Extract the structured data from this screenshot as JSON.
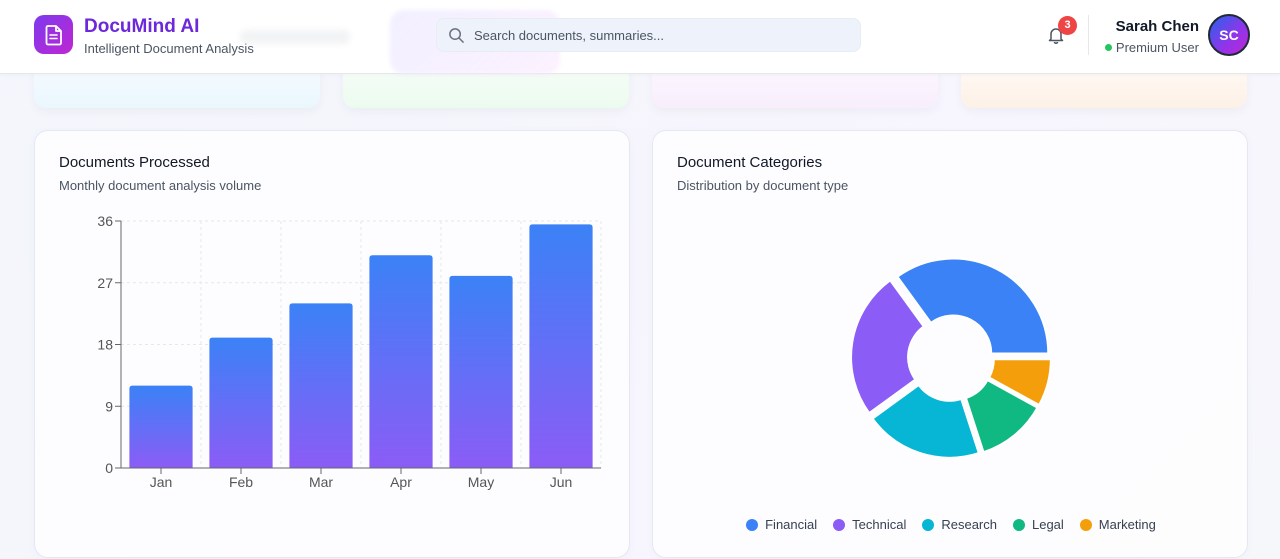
{
  "app": {
    "title": "DocuMind AI",
    "subtitle": "Intelligent Document Analysis",
    "logo_icon": "document-icon",
    "brand_color": "#6d28d9"
  },
  "search": {
    "placeholder": "Search documents, summaries..."
  },
  "notifications": {
    "count": "3"
  },
  "user": {
    "name": "Sarah Chen",
    "status": "Premium User",
    "initials": "SC"
  },
  "bar_card": {
    "title": "Documents Processed",
    "subtitle": "Monthly document analysis volume"
  },
  "pie_card": {
    "title": "Document Categories",
    "subtitle": "Distribution by document type"
  },
  "chart_data": [
    {
      "type": "bar",
      "title": "Documents Processed",
      "subtitle": "Monthly document analysis volume",
      "categories": [
        "Jan",
        "Feb",
        "Mar",
        "Apr",
        "May",
        "Jun"
      ],
      "values": [
        12,
        19,
        24,
        31,
        28,
        35.5
      ],
      "ylim": [
        0,
        36
      ],
      "yticks": [
        0,
        9,
        18,
        27,
        36
      ],
      "grid": true,
      "gradient_colors": [
        "#3b82f6",
        "#8b5cf6"
      ]
    },
    {
      "type": "pie",
      "title": "Document Categories",
      "subtitle": "Distribution by document type",
      "donut": true,
      "labels": [
        "Financial",
        "Technical",
        "Research",
        "Legal",
        "Marketing"
      ],
      "values": [
        35,
        25,
        20,
        12,
        8
      ],
      "colors": [
        "#3b82f6",
        "#8b5cf6",
        "#06b6d4",
        "#10b981",
        "#f59e0b"
      ],
      "legend_position": "bottom"
    }
  ]
}
